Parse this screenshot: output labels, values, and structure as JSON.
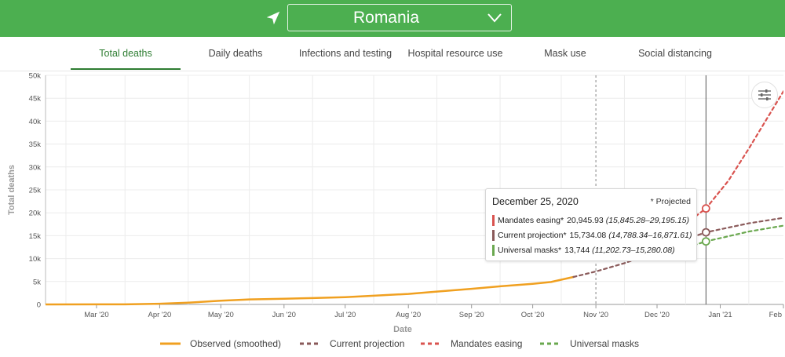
{
  "header": {
    "country": "Romania",
    "location_icon": "navigation-arrow-icon",
    "dropdown_icon": "chevron-down-icon",
    "background_color": "#4caf50"
  },
  "tabs": [
    {
      "label": "Total deaths",
      "active": true
    },
    {
      "label": "Daily deaths",
      "active": false
    },
    {
      "label": "Infections and testing",
      "active": false
    },
    {
      "label": "Hospital resource use",
      "active": false
    },
    {
      "label": "Mask use",
      "active": false
    },
    {
      "label": "Social distancing",
      "active": false
    }
  ],
  "settings_icon": "sliders-icon",
  "tooltip": {
    "date": "December 25, 2020",
    "projected_note": "* Projected",
    "rows": [
      {
        "label": "Mandates easing*",
        "value": "20,945.93",
        "ci": "(15,845.28–29,195.15)",
        "color": "#d9534f"
      },
      {
        "label": "Current projection*",
        "value": "15,734.08",
        "ci": "(14,788.34–16,871.61)",
        "color": "#8a5a5a"
      },
      {
        "label": "Universal masks*",
        "value": "13,744",
        "ci": "(11,202.73–15,280.08)",
        "color": "#6aa84f"
      }
    ]
  },
  "chart_data": {
    "type": "line",
    "xlabel": "Date",
    "ylabel": "Total deaths",
    "x_ticks": [
      "Mar '20",
      "Apr '20",
      "May '20",
      "Jun '20",
      "Jul '20",
      "Aug '20",
      "Sep '20",
      "Oct '20",
      "Nov '20",
      "Dec '20",
      "Jan '21",
      "Feb"
    ],
    "y_ticks": [
      "0",
      "5k",
      "10k",
      "15k",
      "20k",
      "25k",
      "30k",
      "35k",
      "40k",
      "45k",
      "50k"
    ],
    "ylim": [
      0,
      50000
    ],
    "xlim": [
      "2020-02-05",
      "2021-02-01"
    ],
    "grid": true,
    "legend_position": "bottom",
    "today_marker": "2020-11-01",
    "hover_date": "2020-12-25",
    "series": [
      {
        "name": "Observed (smoothed)",
        "color": "#f0a020",
        "style": "solid",
        "points": [
          [
            "2020-02-05",
            0
          ],
          [
            "2020-03-15",
            10
          ],
          [
            "2020-04-01",
            150
          ],
          [
            "2020-04-15",
            400
          ],
          [
            "2020-05-01",
            800
          ],
          [
            "2020-05-15",
            1100
          ],
          [
            "2020-06-01",
            1250
          ],
          [
            "2020-06-15",
            1380
          ],
          [
            "2020-07-01",
            1600
          ],
          [
            "2020-07-15",
            1900
          ],
          [
            "2020-08-01",
            2300
          ],
          [
            "2020-08-15",
            2800
          ],
          [
            "2020-09-01",
            3400
          ],
          [
            "2020-09-15",
            3950
          ],
          [
            "2020-10-01",
            4500
          ],
          [
            "2020-10-10",
            4900
          ],
          [
            "2020-10-21",
            6000
          ]
        ]
      },
      {
        "name": "Current projection",
        "color": "#8a5a5a",
        "style": "dashed",
        "points": [
          [
            "2020-10-21",
            6000
          ],
          [
            "2020-11-01",
            7200
          ],
          [
            "2020-11-15",
            9000
          ],
          [
            "2020-12-01",
            11500
          ],
          [
            "2020-12-15",
            14200
          ],
          [
            "2020-12-25",
            15734.08
          ],
          [
            "2021-01-15",
            17700
          ],
          [
            "2021-02-01",
            18900
          ]
        ]
      },
      {
        "name": "Mandates easing",
        "color": "#d9534f",
        "style": "dashed",
        "points": [
          [
            "2020-12-15",
            17600
          ],
          [
            "2020-12-25",
            20945.93
          ],
          [
            "2021-01-05",
            27000
          ],
          [
            "2021-01-15",
            34000
          ],
          [
            "2021-02-01",
            46500
          ]
        ]
      },
      {
        "name": "Universal masks",
        "color": "#6aa84f",
        "style": "dashed",
        "points": [
          [
            "2020-12-01",
            11000
          ],
          [
            "2020-12-15",
            12400
          ],
          [
            "2020-12-25",
            13744
          ],
          [
            "2021-01-15",
            15900
          ],
          [
            "2021-02-01",
            17200
          ]
        ]
      }
    ]
  }
}
